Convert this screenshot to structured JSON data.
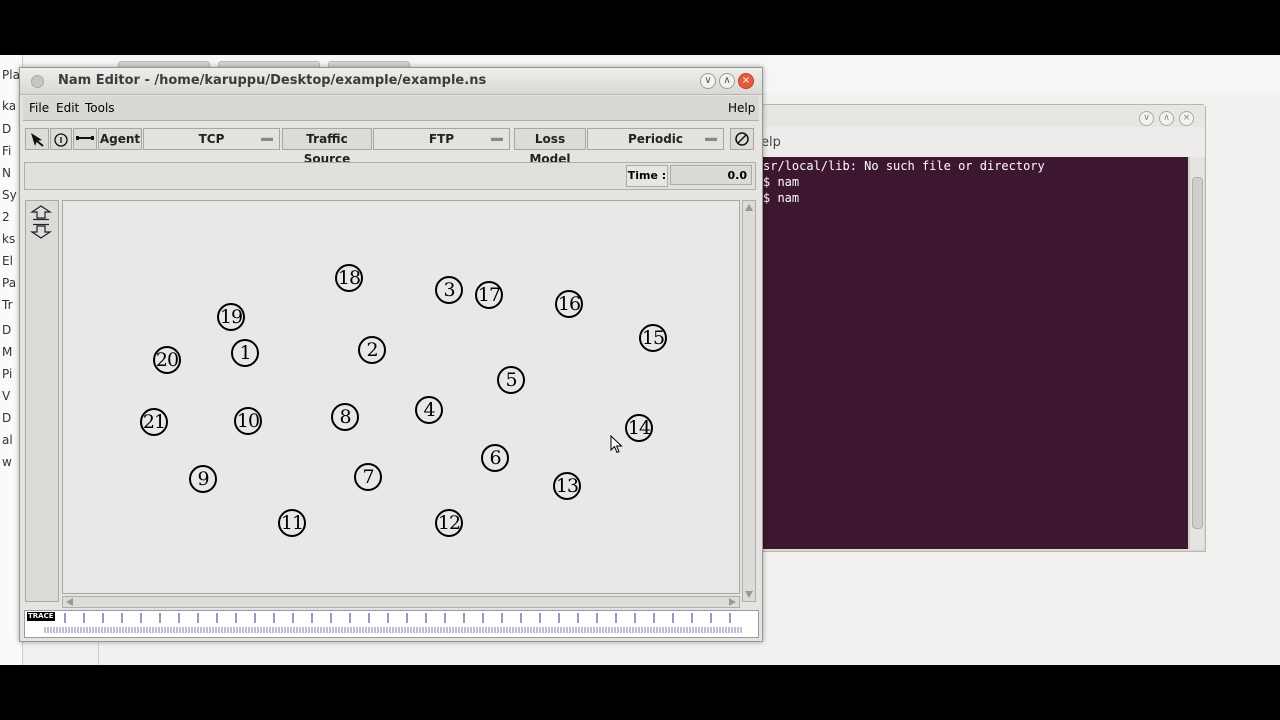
{
  "nam": {
    "title": "Nam Editor - /home/karuppu/Desktop/example/example.ns",
    "menu": {
      "file": "File",
      "edit": "Edit",
      "tools": "Tools",
      "help": "Help"
    },
    "toolbar": {
      "agent": "Agent",
      "agent_value": "TCP",
      "traffic_source": "Traffic Source",
      "traffic_source_value": "FTP",
      "loss_model": "Loss Model",
      "loss_model_value": "Periodic"
    },
    "time_label": "Time :",
    "time_value": "0.0",
    "timeline_label": "TRACE",
    "nodes": [
      {
        "id": "18"
      },
      {
        "id": "3"
      },
      {
        "id": "17"
      },
      {
        "id": "16"
      },
      {
        "id": "19"
      },
      {
        "id": "15"
      },
      {
        "id": "20"
      },
      {
        "id": "1"
      },
      {
        "id": "2"
      },
      {
        "id": "5"
      },
      {
        "id": "21"
      },
      {
        "id": "10"
      },
      {
        "id": "8"
      },
      {
        "id": "4"
      },
      {
        "id": "14"
      },
      {
        "id": "6"
      },
      {
        "id": "9"
      },
      {
        "id": "7"
      },
      {
        "id": "13"
      },
      {
        "id": "11"
      },
      {
        "id": "12"
      }
    ]
  },
  "terminal": {
    "menu_partial": "elp",
    "lines": [
      "sr/local/lib: No such file or directory",
      "$ nam",
      "$ nam"
    ]
  },
  "background_panel": {
    "items": [
      "Plac",
      "ka",
      "D",
      "Fi",
      "N",
      "Sy",
      "2",
      "ks",
      "El",
      "Pa",
      "Tr",
      "D",
      "M",
      "Pi",
      "V",
      "D",
      "al",
      "w"
    ]
  }
}
